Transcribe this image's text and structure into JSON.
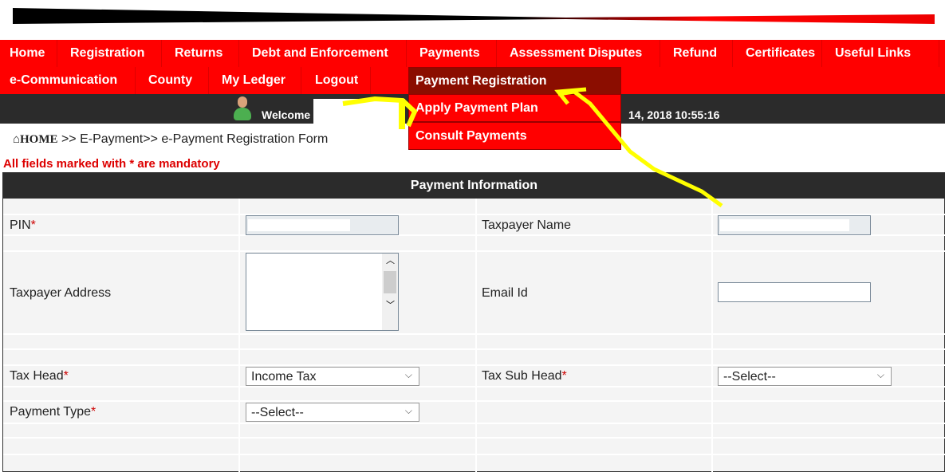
{
  "nav": {
    "row1": [
      "Home",
      "Registration",
      "Returns",
      "Debt and Enforcement",
      "Payments",
      "Assessment Disputes",
      "Refund",
      "Certificates",
      "Useful Links"
    ],
    "row2": [
      "e-Communication",
      "County",
      "My Ledger",
      "Logout"
    ],
    "payments_menu": [
      "Payment Registration",
      "Apply Payment Plan",
      "Consult Payments"
    ]
  },
  "welcome": {
    "text": "Welcome",
    "datetime": "14, 2018 10:55:16"
  },
  "breadcrumb": {
    "home": "HOME",
    "path": " >> E-Payment>> e-Payment Registration Form"
  },
  "mandatory_note": "All fields marked with * are mandatory",
  "form": {
    "title": "Payment Information",
    "pin_label": "PIN",
    "taxpayer_name_label": "Taxpayer Name",
    "address_label": "Taxpayer Address",
    "email_label": "Email Id",
    "tax_head_label": "Tax Head",
    "tax_head_value": "Income Tax",
    "tax_sub_head_label": "Tax Sub Head",
    "tax_sub_head_value": "--Select--",
    "payment_type_label": "Payment Type",
    "payment_type_value": "--Select--",
    "required_mark": "*"
  },
  "colors": {
    "nav": "#ff0000",
    "dropdown_active": "#8b0d00",
    "dark_bar": "#2b2b2b",
    "annotation": "#ffff00"
  }
}
